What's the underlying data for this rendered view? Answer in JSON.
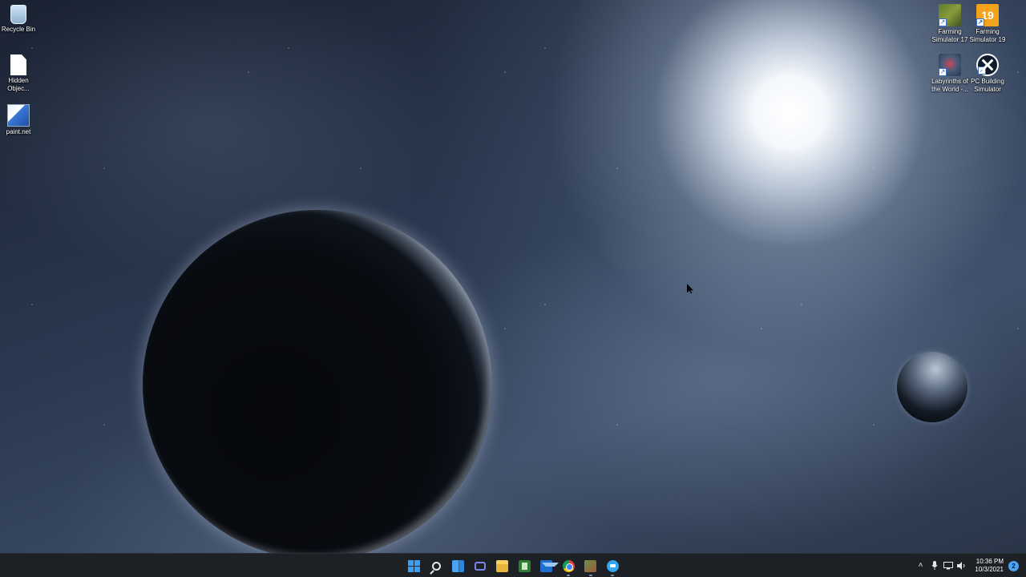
{
  "desktop": {
    "icons_left": [
      {
        "label": "Recycle Bin",
        "icon": "recycle-bin-icon"
      },
      {
        "label": "Hidden Objec...",
        "icon": "document-icon"
      },
      {
        "label": "paint.net",
        "icon": "paint-net-icon"
      }
    ],
    "icons_right": [
      {
        "label": "Farming Simulator 17",
        "icon": "farming-simulator-17-icon"
      },
      {
        "label": "Farming Simulator 19",
        "icon": "farming-simulator-19-icon",
        "badge": "19"
      },
      {
        "label": "Labyrinths of the World -...",
        "icon": "labyrinths-icon"
      },
      {
        "label": "PC Building Simulator",
        "icon": "pc-building-simulator-icon"
      }
    ]
  },
  "taskbar": {
    "pinned": [
      {
        "name": "start",
        "icon": "windows-start-icon"
      },
      {
        "name": "search",
        "icon": "search-icon"
      },
      {
        "name": "widgets",
        "icon": "widgets-icon"
      },
      {
        "name": "chat",
        "icon": "chat-icon"
      },
      {
        "name": "file-explorer",
        "icon": "folder-icon"
      },
      {
        "name": "notepad",
        "icon": "notepad-icon"
      },
      {
        "name": "mail",
        "icon": "mail-icon"
      },
      {
        "name": "chrome",
        "icon": "chrome-icon",
        "running": true
      },
      {
        "name": "game",
        "icon": "game-icon",
        "running": true
      },
      {
        "name": "messenger",
        "icon": "messenger-icon",
        "running": true
      }
    ],
    "tray": {
      "chevron": "˄",
      "icons": [
        "microphone-icon",
        "network-icon",
        "volume-icon"
      ],
      "time": "10:36 PM",
      "date": "10/3/2021",
      "notification_count": "2"
    }
  },
  "colors": {
    "taskbar_bg": "#1d2025",
    "accent": "#3aa0f3"
  }
}
